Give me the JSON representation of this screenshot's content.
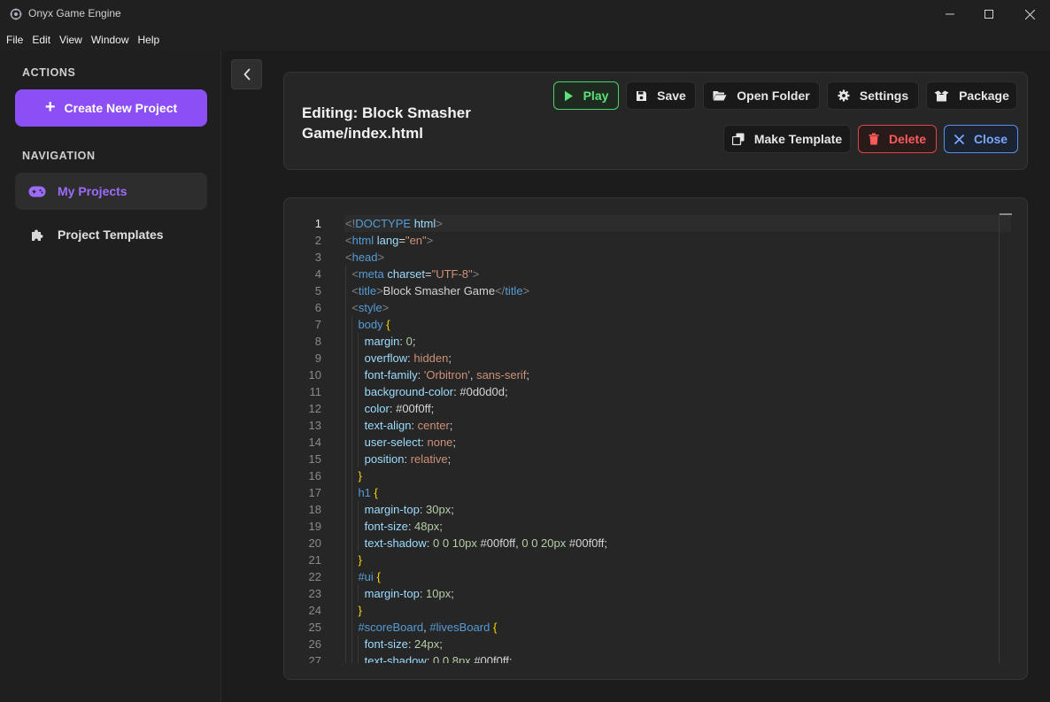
{
  "window": {
    "title": "Onyx Game Engine",
    "controls": [
      "minimize",
      "maximize",
      "close"
    ]
  },
  "menu": [
    "File",
    "Edit",
    "View",
    "Window",
    "Help"
  ],
  "sidebar": {
    "actions_label": "ACTIONS",
    "create_button": "Create New Project",
    "navigation_label": "NAVIGATION",
    "items": [
      {
        "label": "My Projects",
        "icon": "gamepad-icon",
        "active": true
      },
      {
        "label": "Project Templates",
        "icon": "puzzle-icon",
        "active": false
      }
    ]
  },
  "header": {
    "title": "Editing: Block Smasher Game/index.html",
    "buttons": {
      "play": "Play",
      "save": "Save",
      "open_folder": "Open Folder",
      "settings": "Settings",
      "package": "Package",
      "make_template": "Make Template",
      "delete": "Delete",
      "close": "Close"
    }
  },
  "colors": {
    "accent": "#8b4ff5",
    "play": "#4bd36b",
    "delete": "#e0444a",
    "close": "#5a8df0"
  },
  "editor": {
    "current_line": 1,
    "lines": [
      "<!DOCTYPE html>",
      "<html lang=\"en\">",
      "<head>",
      "  <meta charset=\"UTF-8\">",
      "  <title>Block Smasher Game</title>",
      "  <style>",
      "    body {",
      "      margin: 0;",
      "      overflow: hidden;",
      "      font-family: 'Orbitron', sans-serif;",
      "      background-color: #0d0d0d;",
      "      color: #00f0ff;",
      "      text-align: center;",
      "      user-select: none;",
      "      position: relative;",
      "    }",
      "    h1 {",
      "      margin-top: 30px;",
      "      font-size: 48px;",
      "      text-shadow: 0 0 10px #00f0ff, 0 0 20px #00f0ff;",
      "    }",
      "    #ui {",
      "      margin-top: 10px;",
      "    }",
      "    #scoreBoard, #livesBoard {",
      "      font-size: 24px;",
      "      text-shadow: 0 0 8px #00f0ff;"
    ]
  }
}
